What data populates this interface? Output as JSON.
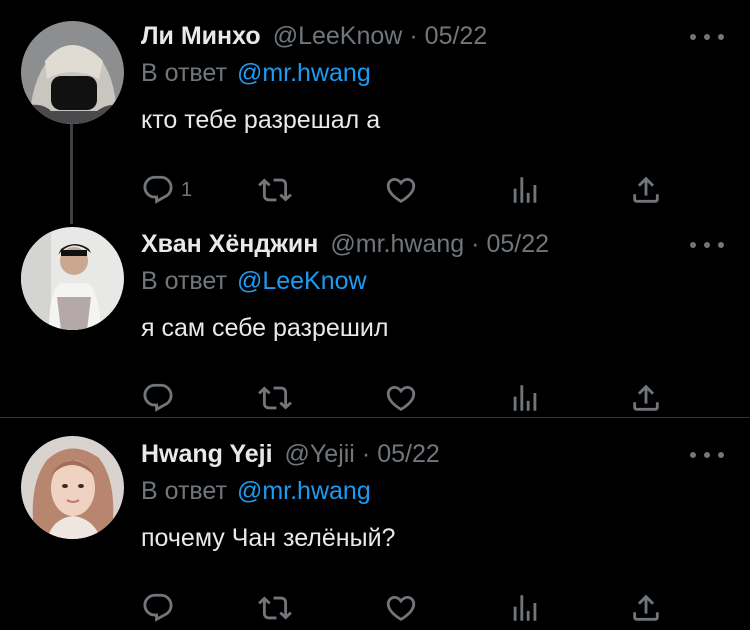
{
  "tweets": [
    {
      "name": "Ли Минхо",
      "handle": "@LeeKnow",
      "separator": "·",
      "date": "05/22",
      "reply_prefix": "В ответ",
      "reply_to": "@mr.hwang",
      "text": "кто тебе разрешал а",
      "reply_count": "1"
    },
    {
      "name": "Хван Хёнджин",
      "handle": "@mr.hwang",
      "separator": "·",
      "date": "05/22",
      "reply_prefix": "В ответ",
      "reply_to": "@LeeKnow",
      "text": "я сам себе разрешил",
      "reply_count": ""
    },
    {
      "name": "Hwang Yeji",
      "handle": "@Yejii",
      "separator": "·",
      "date": "05/22",
      "reply_prefix": "В ответ",
      "reply_to": "@mr.hwang",
      "text": "почему Чан зелёный?",
      "reply_count": ""
    }
  ],
  "icons": {
    "reply": "reply-icon",
    "retweet": "retweet-icon",
    "like": "heart-icon",
    "views": "views-icon",
    "share": "share-icon",
    "more": "more-icon"
  },
  "colors": {
    "background": "#000000",
    "text": "#e7e9ea",
    "secondary": "#71767b",
    "link": "#1d9bf0",
    "divider": "#2f3336"
  }
}
